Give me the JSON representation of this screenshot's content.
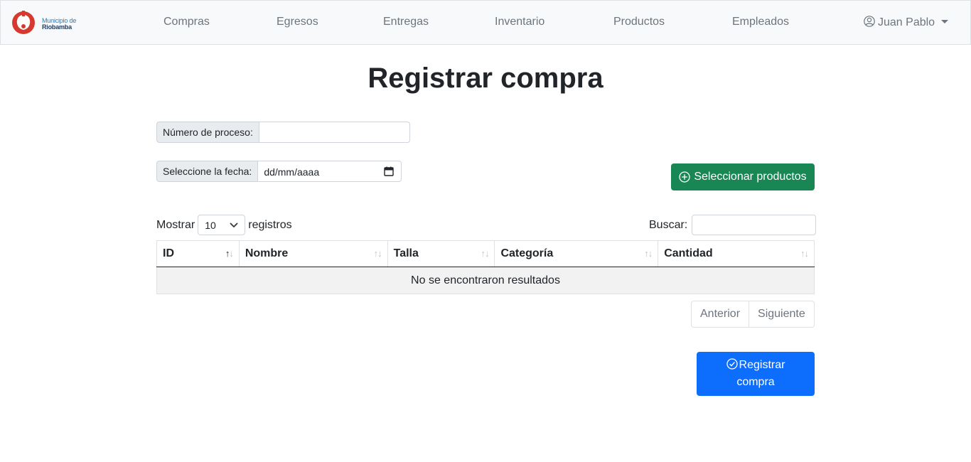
{
  "brand": {
    "name_line1": "Municipio de",
    "name_line2": "Riobamba"
  },
  "nav": {
    "items": [
      {
        "label": "Compras"
      },
      {
        "label": "Egresos"
      },
      {
        "label": "Entregas"
      },
      {
        "label": "Inventario"
      },
      {
        "label": "Productos"
      },
      {
        "label": "Empleados"
      }
    ],
    "user": {
      "name": "Juan Pablo",
      "icon": "user-circle-icon"
    }
  },
  "page": {
    "title": "Registrar compra"
  },
  "form": {
    "process_number": {
      "label": "Número de proceso:",
      "value": ""
    },
    "date": {
      "label": "Seleccione la fecha:",
      "placeholder": "dd/mm/aaaa",
      "icon": "calendar-icon"
    },
    "select_products_button": {
      "label": "Seleccionar productos",
      "icon": "plus-circle-icon",
      "color": "#198754"
    }
  },
  "datatable": {
    "length": {
      "prefix": "Mostrar",
      "value": "10",
      "suffix": "registros"
    },
    "search": {
      "label": "Buscar:",
      "value": ""
    },
    "columns": [
      {
        "label": "ID"
      },
      {
        "label": "Nombre"
      },
      {
        "label": "Talla"
      },
      {
        "label": "Categoría"
      },
      {
        "label": "Cantidad"
      }
    ],
    "empty_message": "No se encontraron resultados",
    "pagination": {
      "previous": "Anterior",
      "next": "Siguiente"
    }
  },
  "register_button": {
    "line1": "Registrar",
    "line2": "compra",
    "icon": "check-circle-icon",
    "color": "#0d6efd"
  }
}
